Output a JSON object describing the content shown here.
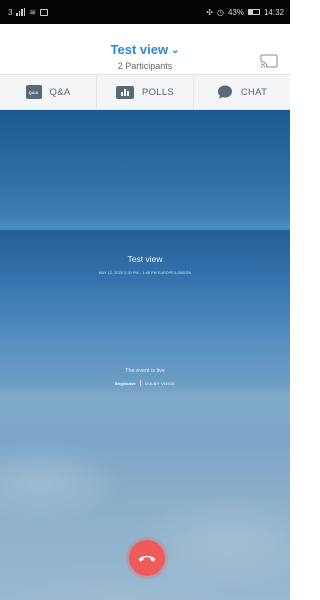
{
  "status_bar": {
    "left_text": "3",
    "right_text": "43%",
    "time": "14:32"
  },
  "header": {
    "title": "Test view",
    "participants": "2 Participants"
  },
  "tabs": [
    {
      "icon": "qa-icon",
      "icon_text": "Q&A",
      "label": "Q&A"
    },
    {
      "icon": "polls-icon",
      "label": "POLLS"
    },
    {
      "icon": "chat-icon",
      "label": "CHAT"
    }
  ],
  "video": {
    "event_title": "Test view",
    "event_date": "MAY 12, 2020 2:30 PM - 3:45 PM EUROPE/LONDON",
    "event_status": "The event is live",
    "brand_1": "Brightcove",
    "brand_2": "DOLBY VOICE"
  },
  "colors": {
    "accent": "#2a8ad8",
    "tab_text": "#556270",
    "hangup": "#ef5b5b"
  }
}
